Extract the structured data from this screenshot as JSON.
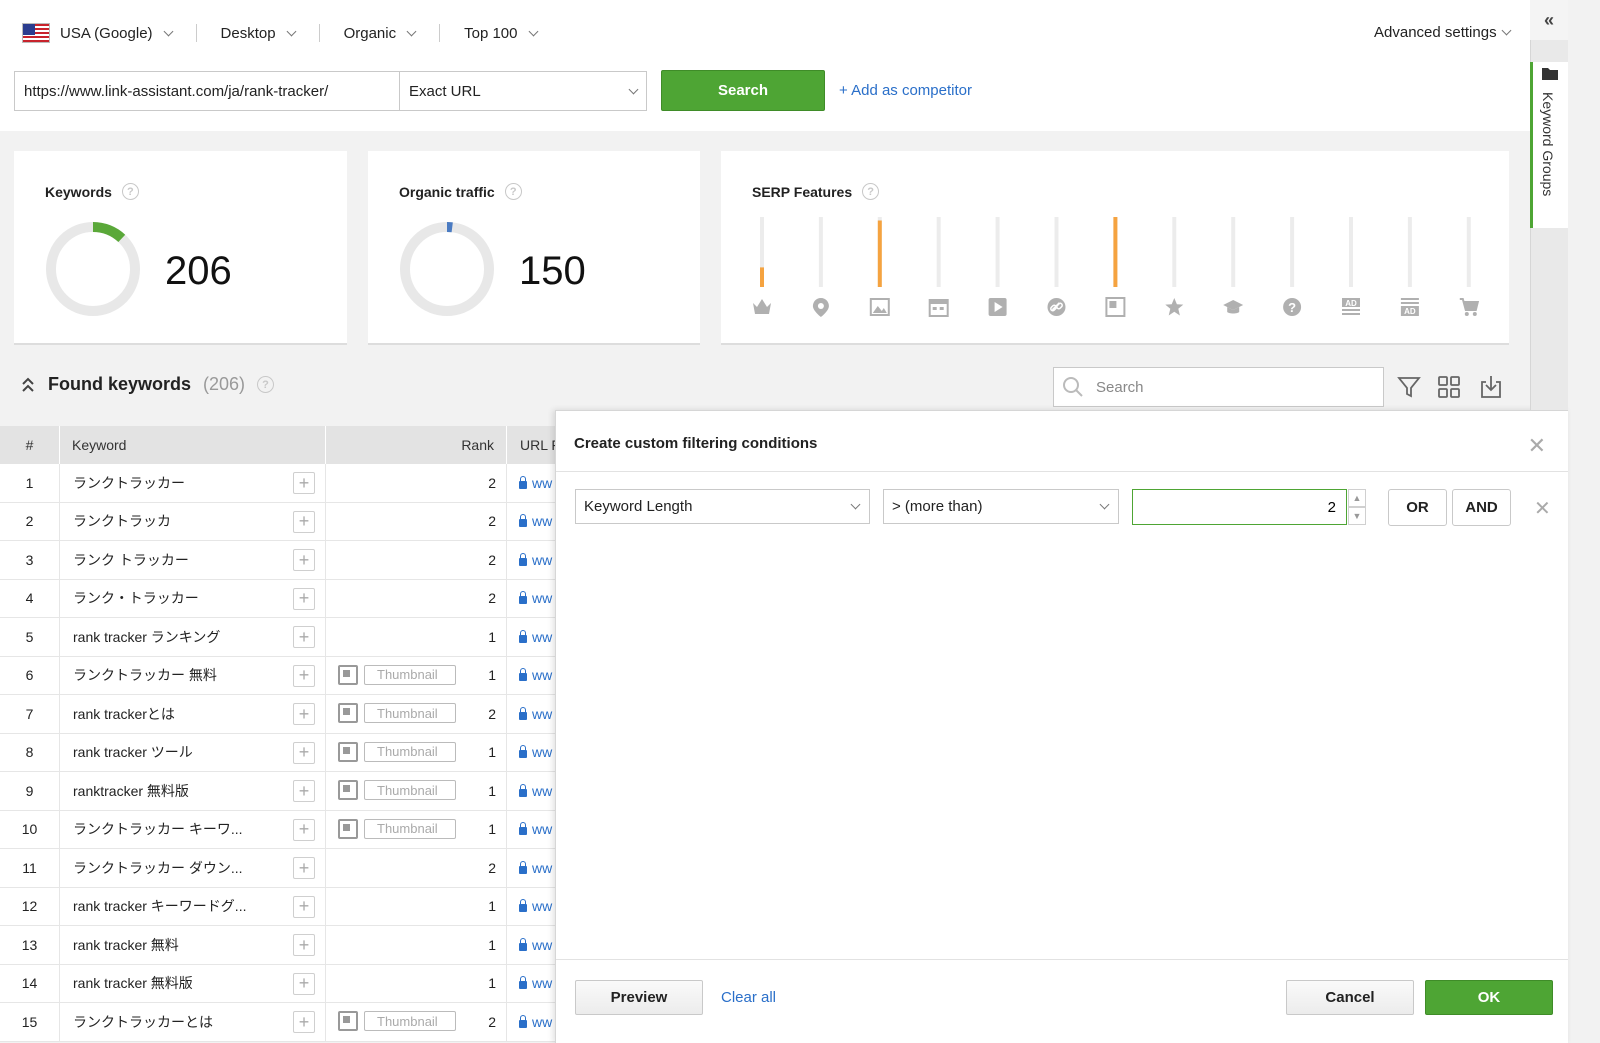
{
  "toolbar": {
    "country": "USA (Google)",
    "device": "Desktop",
    "type": "Organic",
    "depth": "Top 100",
    "advanced": "Advanced settings"
  },
  "search_bar": {
    "url": "https://www.link-assistant.com/ja/rank-tracker/",
    "match": "Exact URL",
    "search_btn": "Search",
    "add_competitor": "+ Add as competitor"
  },
  "cards": {
    "keywords": {
      "title": "Keywords",
      "value": "206",
      "donut_fraction": 0.12
    },
    "traffic": {
      "title": "Organic traffic",
      "value": "150",
      "donut_fraction": 0.02
    },
    "serp": {
      "title": "SERP Features",
      "bars": [
        {
          "icon": "crown-icon",
          "level": 0.28
        },
        {
          "icon": "map-pin-icon",
          "level": 0
        },
        {
          "icon": "image-icon",
          "level": 0.95
        },
        {
          "icon": "calendar-icon",
          "level": 0
        },
        {
          "icon": "video-icon",
          "level": 0
        },
        {
          "icon": "link-icon",
          "level": 0
        },
        {
          "icon": "thumbnail-icon",
          "level": 1.0
        },
        {
          "icon": "star-icon",
          "level": 0
        },
        {
          "icon": "graduation-icon",
          "level": 0
        },
        {
          "icon": "question-icon",
          "level": 0
        },
        {
          "icon": "ad-top-icon",
          "level": 0
        },
        {
          "icon": "ad-bottom-icon",
          "level": 0
        },
        {
          "icon": "cart-icon",
          "level": 0
        }
      ],
      "bar_color": "#f5a340",
      "track_color": "#ececec"
    }
  },
  "found": {
    "title": "Found keywords",
    "count": "(206)",
    "search_placeholder": "Search"
  },
  "table": {
    "headers": {
      "num": "#",
      "keyword": "Keyword",
      "rank": "Rank",
      "url": "URL F"
    },
    "thumbnail_label": "Thumbnail",
    "url_text": "ww",
    "rows": [
      {
        "n": "1",
        "kw": "ランクトラッカー",
        "rank": "2",
        "thumb": false
      },
      {
        "n": "2",
        "kw": "ランクトラッカ",
        "rank": "2",
        "thumb": false
      },
      {
        "n": "3",
        "kw": "ランク トラッカー",
        "rank": "2",
        "thumb": false
      },
      {
        "n": "4",
        "kw": "ランク・トラッカー",
        "rank": "2",
        "thumb": false
      },
      {
        "n": "5",
        "kw": "rank tracker ランキング",
        "rank": "1",
        "thumb": false
      },
      {
        "n": "6",
        "kw": "ランクトラッカー 無料",
        "rank": "1",
        "thumb": true
      },
      {
        "n": "7",
        "kw": "rank trackerとは",
        "rank": "2",
        "thumb": true
      },
      {
        "n": "8",
        "kw": "rank tracker ツール",
        "rank": "1",
        "thumb": true
      },
      {
        "n": "9",
        "kw": "ranktracker 無料版",
        "rank": "1",
        "thumb": true
      },
      {
        "n": "10",
        "kw": "ランクトラッカー キーワ...",
        "rank": "1",
        "thumb": true
      },
      {
        "n": "11",
        "kw": "ランクトラッカー ダウン...",
        "rank": "2",
        "thumb": false
      },
      {
        "n": "12",
        "kw": "rank tracker キーワードグ...",
        "rank": "1",
        "thumb": false
      },
      {
        "n": "13",
        "kw": "rank tracker 無料",
        "rank": "1",
        "thumb": false
      },
      {
        "n": "14",
        "kw": "rank tracker 無料版",
        "rank": "1",
        "thumb": false
      },
      {
        "n": "15",
        "kw": "ランクトラッカーとは",
        "rank": "2",
        "thumb": true
      }
    ]
  },
  "dialog": {
    "title": "Create custom filtering conditions",
    "field": "Keyword Length",
    "operator": "> (more than)",
    "value": "2",
    "or_btn": "OR",
    "and_btn": "AND",
    "preview_btn": "Preview",
    "clear_all": "Clear all",
    "cancel_btn": "Cancel",
    "ok_btn": "OK"
  },
  "rail": {
    "collapse": "«",
    "tab_label": "Keyword Groups"
  }
}
